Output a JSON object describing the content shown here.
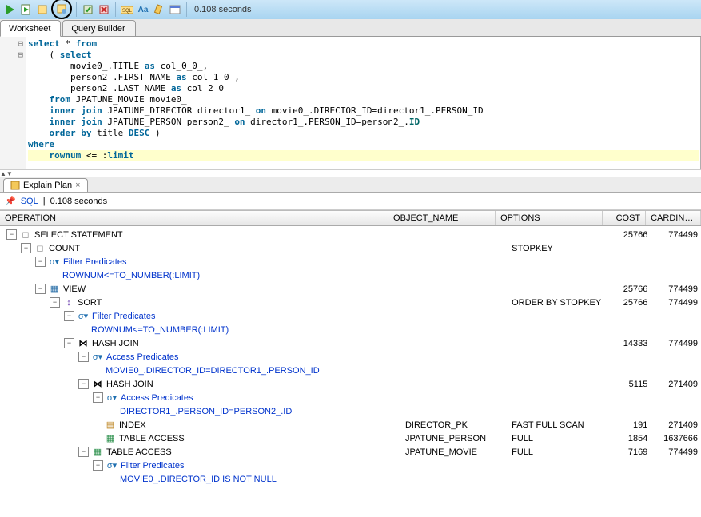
{
  "toolbar": {
    "timing": "0.108 seconds",
    "icons": [
      "run",
      "script",
      "explain",
      "autotrace",
      "sep",
      "commit",
      "rollback",
      "sep",
      "sql",
      "case",
      "clear",
      "sched"
    ]
  },
  "tabs": {
    "worksheet": "Worksheet",
    "query_builder": "Query Builder"
  },
  "sql": {
    "l1_a": "select",
    "l1_b": " * ",
    "l1_c": "from",
    "l2_a": "    ( ",
    "l2_b": "select",
    "l3": "        movie0_.TITLE ",
    "l3_as": "as",
    "l3_b": " col_0_0_,",
    "l4": "        person2_.FIRST_NAME ",
    "l4_as": "as",
    "l4_b": " col_1_0_,",
    "l5": "        person2_.LAST_NAME ",
    "l5_as": "as",
    "l5_b": " col_2_0_",
    "l6_a": "    from",
    "l6_b": " JPATUNE_MOVIE movie0_",
    "l7_a": "    inner",
    "l7_b": " join",
    "l7_c": " JPATUNE_DIRECTOR director1_ ",
    "l7_d": "on",
    "l7_e": " movie0_.DIRECTOR_ID=director1_.PERSON_ID",
    "l8_a": "    inner",
    "l8_b": " join",
    "l8_c": " JPATUNE_PERSON person2_ ",
    "l8_d": "on",
    "l8_e": " director1_.PERSON_ID=person2_.",
    "l8_f": "ID",
    "l9_a": "    order",
    "l9_b": " by",
    "l9_c": " title ",
    "l9_d": "DESC",
    "l9_e": " )",
    "l10": "where",
    "l11_a": "    rownum",
    "l11_b": " <= :",
    "l11_c": "limit"
  },
  "result_tab": {
    "label": "Explain Plan"
  },
  "result_header": {
    "sql": "SQL",
    "sep": "|",
    "timing": "0.108 seconds"
  },
  "grid": {
    "cols": {
      "operation": "OPERATION",
      "object_name": "OBJECT_NAME",
      "options": "OPTIONS",
      "cost": "COST",
      "cardinality": "CARDINALITY"
    }
  },
  "plan": {
    "r0": {
      "op": "SELECT STATEMENT",
      "cost": "25766",
      "card": "774499"
    },
    "r1": {
      "op": "COUNT",
      "opt": "STOPKEY"
    },
    "r2": {
      "op": "Filter Predicates"
    },
    "r2a": {
      "detail": "ROWNUM<=TO_NUMBER(:LIMIT)"
    },
    "r3": {
      "op": "VIEW",
      "cost": "25766",
      "card": "774499"
    },
    "r4": {
      "op": "SORT",
      "opt": "ORDER BY STOPKEY",
      "cost": "25766",
      "card": "774499"
    },
    "r5": {
      "op": "Filter Predicates"
    },
    "r5a": {
      "detail": "ROWNUM<=TO_NUMBER(:LIMIT)"
    },
    "r6": {
      "op": "HASH JOIN",
      "cost": "14333",
      "card": "774499"
    },
    "r7": {
      "op": "Access Predicates"
    },
    "r7a": {
      "detail": "MOVIE0_.DIRECTOR_ID=DIRECTOR1_.PERSON_ID"
    },
    "r8": {
      "op": "HASH JOIN",
      "cost": "5115",
      "card": "271409"
    },
    "r9": {
      "op": "Access Predicates"
    },
    "r9a": {
      "detail": "DIRECTOR1_.PERSON_ID=PERSON2_.ID"
    },
    "r10": {
      "op": "INDEX",
      "obj": "DIRECTOR_PK",
      "opt": "FAST FULL SCAN",
      "cost": "191",
      "card": "271409"
    },
    "r11": {
      "op": "TABLE ACCESS",
      "obj": "JPATUNE_PERSON",
      "opt": "FULL",
      "cost": "1854",
      "card": "1637666"
    },
    "r12": {
      "op": "TABLE ACCESS",
      "obj": "JPATUNE_MOVIE",
      "opt": "FULL",
      "cost": "7169",
      "card": "774499"
    },
    "r13": {
      "op": "Filter Predicates"
    },
    "r13a": {
      "detail": "MOVIE0_.DIRECTOR_ID IS NOT NULL"
    }
  }
}
